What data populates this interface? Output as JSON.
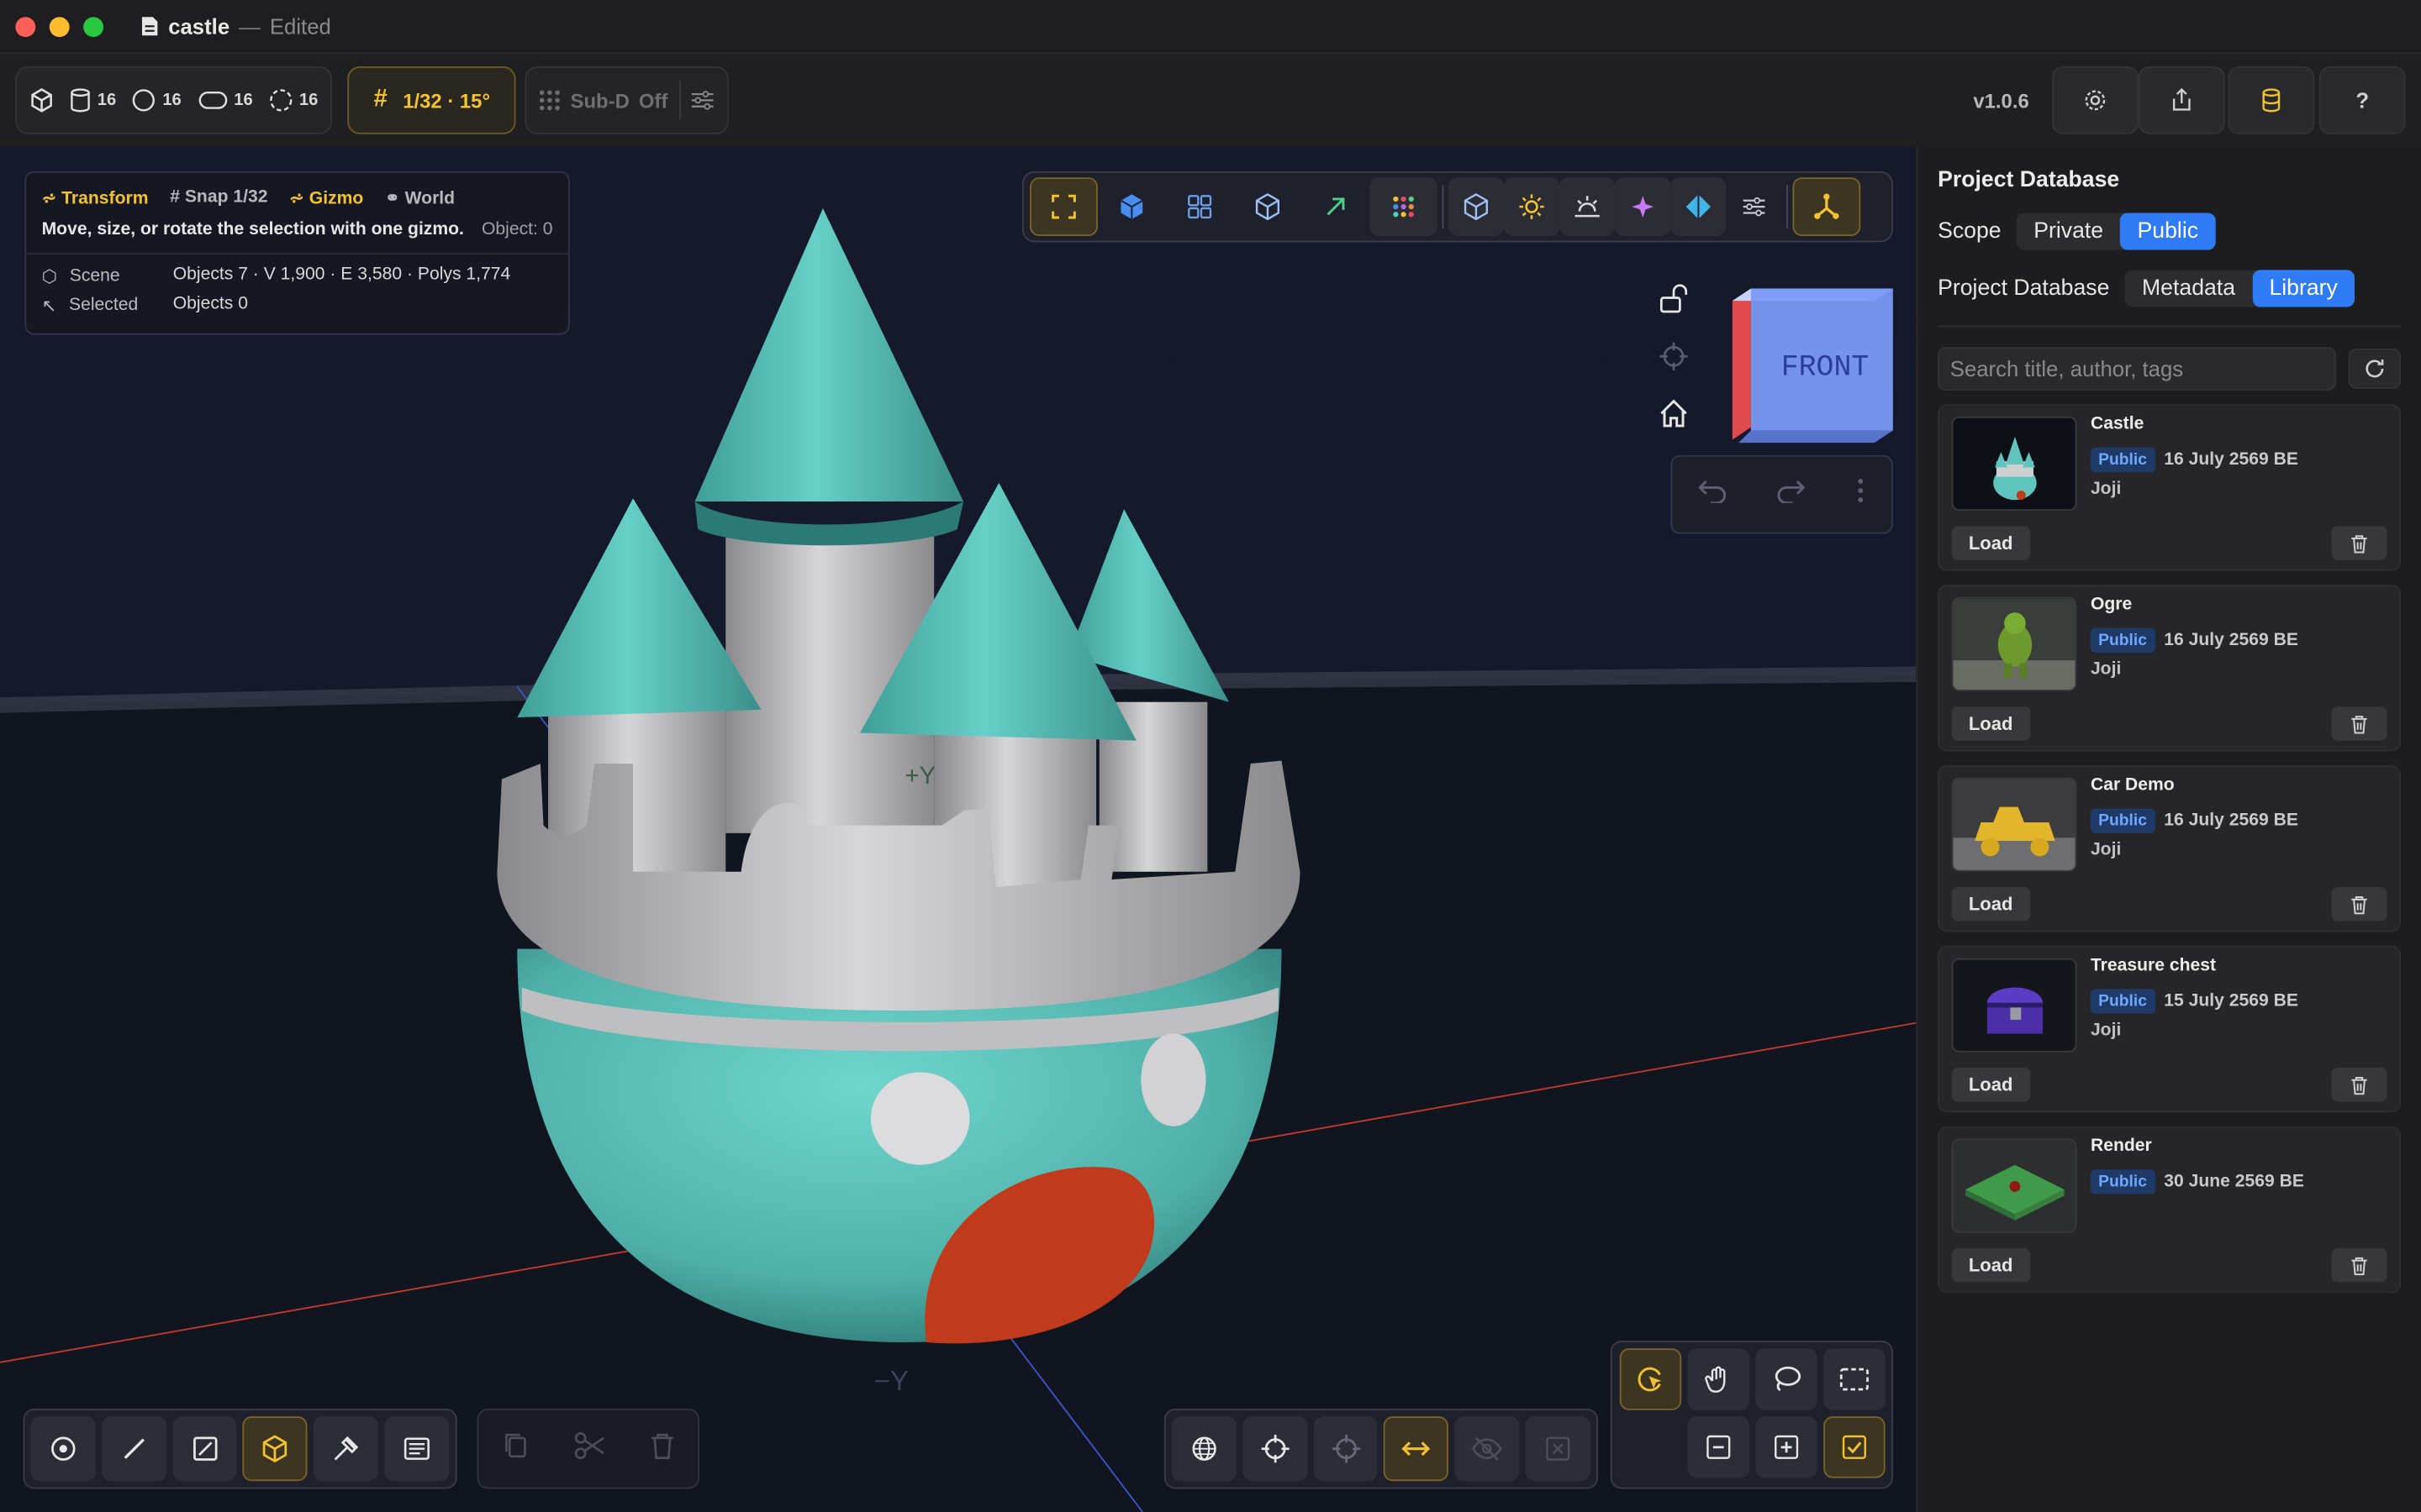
{
  "window": {
    "doc_name": "castle",
    "separator": "—",
    "state": "Edited"
  },
  "toolbar": {
    "counts": [
      {
        "icon": "cylinder-icon",
        "value": "16"
      },
      {
        "icon": "circle-icon",
        "value": "16"
      },
      {
        "icon": "capsule-icon",
        "value": "16"
      },
      {
        "icon": "dashed-circle-icon",
        "value": "16"
      }
    ],
    "snap_label": "1/32 · 15°",
    "subd_label": "Sub-D",
    "subd_state": "Off",
    "version": "v1.0.6"
  },
  "info": {
    "mode": "Transform",
    "snap": "Snap 1/32",
    "gizmo": "Gizmo",
    "space": "World",
    "hint": "Move, size, or rotate the selection with one gizmo.",
    "object_label": "Object: 0",
    "scene_label": "Scene",
    "scene_stats": "Objects 7 · V 1,900 · E 3,580 · Polys 1,774",
    "selected_label": "Selected",
    "selected_stats": "Objects 0"
  },
  "viewcube": {
    "face_label": "FRONT"
  },
  "axis_labels": {
    "plus_y": "+Y",
    "minus_y": "−Y"
  },
  "panel": {
    "title": "Project Database",
    "scope_label": "Scope",
    "scope_options": [
      "Private",
      "Public"
    ],
    "scope_selected": "Public",
    "db_label": "Project Database",
    "db_options": [
      "Metadata",
      "Library"
    ],
    "db_selected": "Library",
    "search_placeholder": "Search title, author, tags",
    "load_label": "Load",
    "items": [
      {
        "title": "Castle",
        "badge": "Public",
        "date": "16 July 2569 BE",
        "author": "Joji"
      },
      {
        "title": "Ogre",
        "badge": "Public",
        "date": "16 July 2569 BE",
        "author": "Joji"
      },
      {
        "title": "Car Demo",
        "badge": "Public",
        "date": "16 July 2569 BE",
        "author": "Joji"
      },
      {
        "title": "Treasure chest",
        "badge": "Public",
        "date": "15 July 2569 BE",
        "author": "Joji"
      },
      {
        "title": "Render",
        "badge": "Public",
        "date": "30 June 2569 BE",
        "author": ""
      }
    ]
  },
  "colors": {
    "accent": "#f2c230",
    "select_blue": "#2f7bf5",
    "castle_teal": "#5ec4bd",
    "castle_wall": "#c9c9cc",
    "door_red": "#c23a1c"
  }
}
